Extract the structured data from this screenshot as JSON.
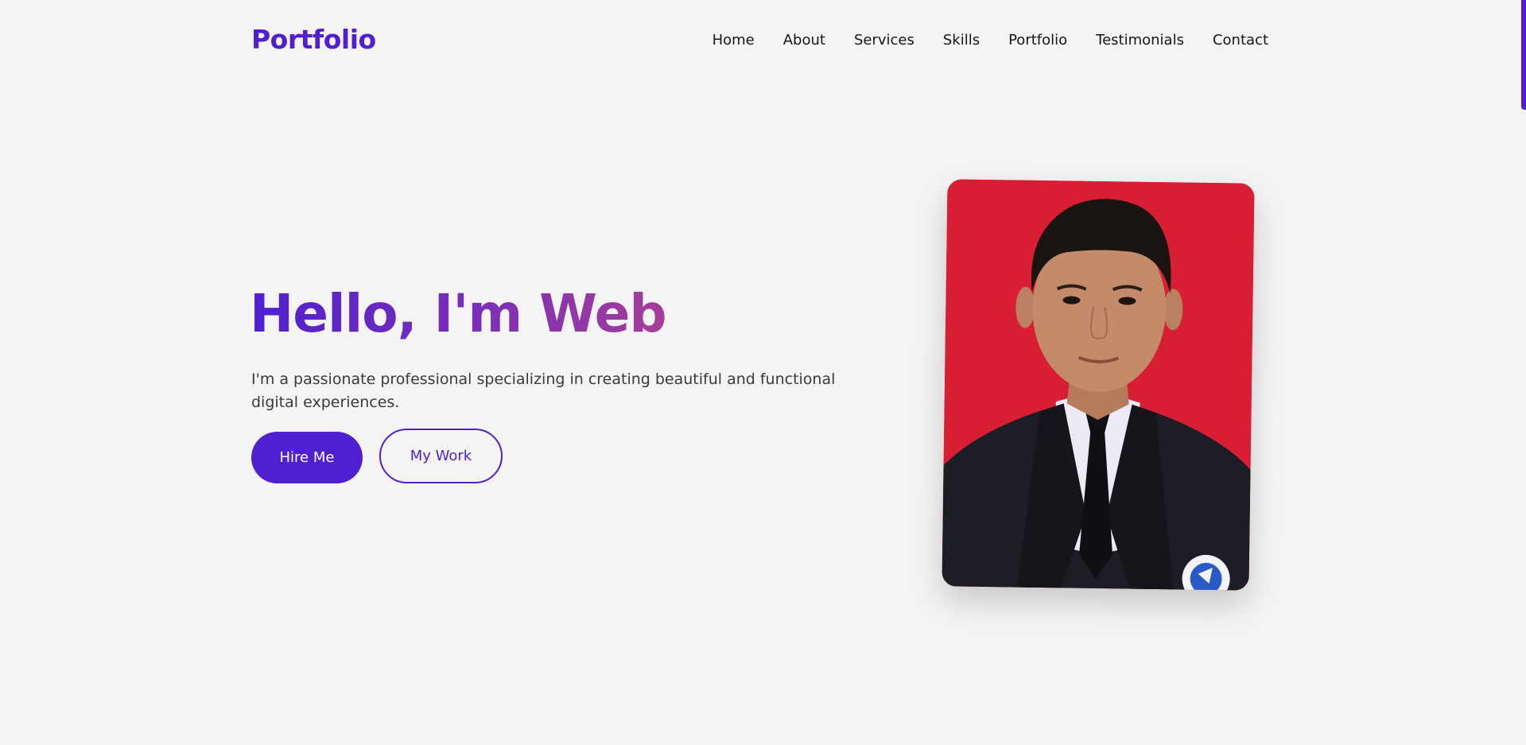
{
  "header": {
    "logo": "Portfolio",
    "nav": [
      "Home",
      "About",
      "Services",
      "Skills",
      "Portfolio",
      "Testimonials",
      "Contact"
    ]
  },
  "hero": {
    "title": "Hello, I'm Web",
    "description": "I'm a passionate professional specializing in creating beautiful and functional digital experiences.",
    "primary_button": "Hire Me",
    "secondary_button": "My Work"
  },
  "colors": {
    "accent": "#4f1fd1",
    "gradient_end": "#a63e98",
    "photo_background": "#d81e33",
    "page_background": "#f4f4f5"
  },
  "icons": {
    "badge": "school-badge-icon"
  }
}
